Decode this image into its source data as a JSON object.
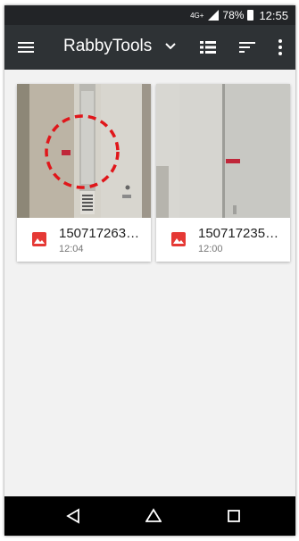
{
  "status_bar": {
    "network": "4G+",
    "battery": "78%",
    "time": "12:55"
  },
  "app_bar": {
    "title": "RabbyTools",
    "icons": [
      "menu-icon",
      "chevron-down-icon",
      "list-view-icon",
      "sort-icon",
      "more-vert-icon"
    ]
  },
  "files": [
    {
      "name": "150717263…",
      "time": "12:04",
      "icon": "image-icon"
    },
    {
      "name": "150717235…",
      "time": "12:00",
      "icon": "image-icon"
    }
  ],
  "nav_bar": {
    "icons": [
      "back-icon",
      "home-icon",
      "recents-icon"
    ]
  },
  "colors": {
    "status_bar": "#222427",
    "app_bar": "#2e3235",
    "background": "#f2f2f2",
    "image_icon": "#e53935",
    "annotation_circle": "#e0161a"
  }
}
